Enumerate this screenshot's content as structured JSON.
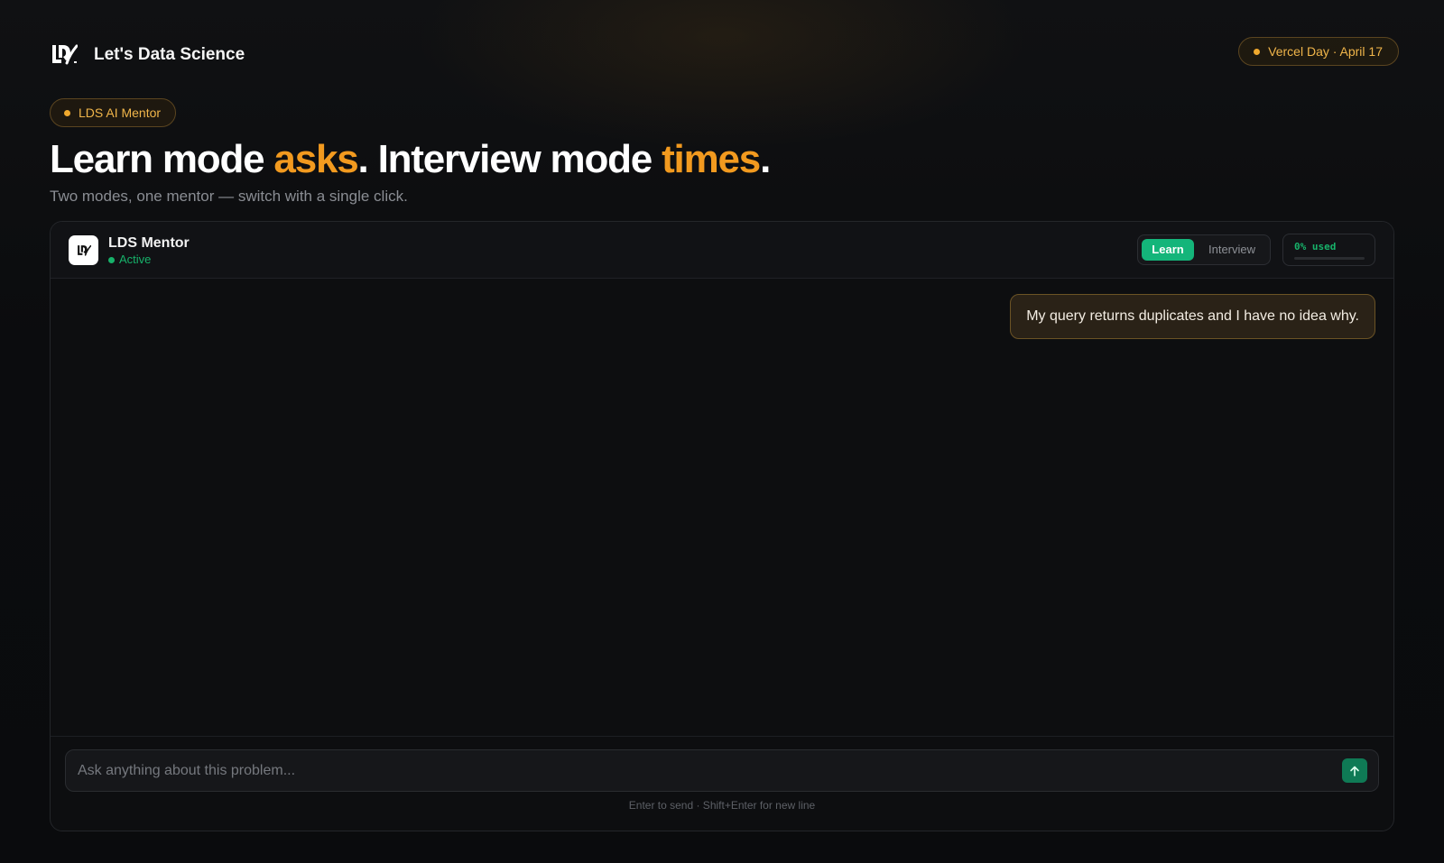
{
  "brand": {
    "name": "Let's Data Science",
    "logo_icon": "lds-logo-icon"
  },
  "event_badge": {
    "label": "Vercel Day · April 17"
  },
  "hero": {
    "tag": "LDS AI Mentor",
    "headline": {
      "part1": "Learn mode ",
      "accent1": "asks",
      "part2": ". Interview mode ",
      "accent2": "times",
      "part3": "."
    },
    "subtitle": "Two modes, one mentor — switch with a single click."
  },
  "chat": {
    "mentor_name": "LDS Mentor",
    "status": "Active",
    "modes": [
      "Learn",
      "Interview"
    ],
    "active_mode": "Learn",
    "usage_label": "0% used",
    "usage_percent": 0,
    "messages": [
      {
        "role": "user",
        "text": "My query returns duplicates and I have no idea why."
      }
    ],
    "composer": {
      "placeholder": "Ask anything about this problem...",
      "value": "",
      "send_icon": "arrow-up-icon"
    },
    "hint": "Enter to send · Shift+Enter for new line"
  },
  "colors": {
    "accent": "#f29a1f",
    "badge_text": "#f0b54a",
    "active_green": "#17b26a",
    "learn_button": "#14b57a",
    "send_button": "#0f7a55",
    "background": "#0b0c0e"
  }
}
